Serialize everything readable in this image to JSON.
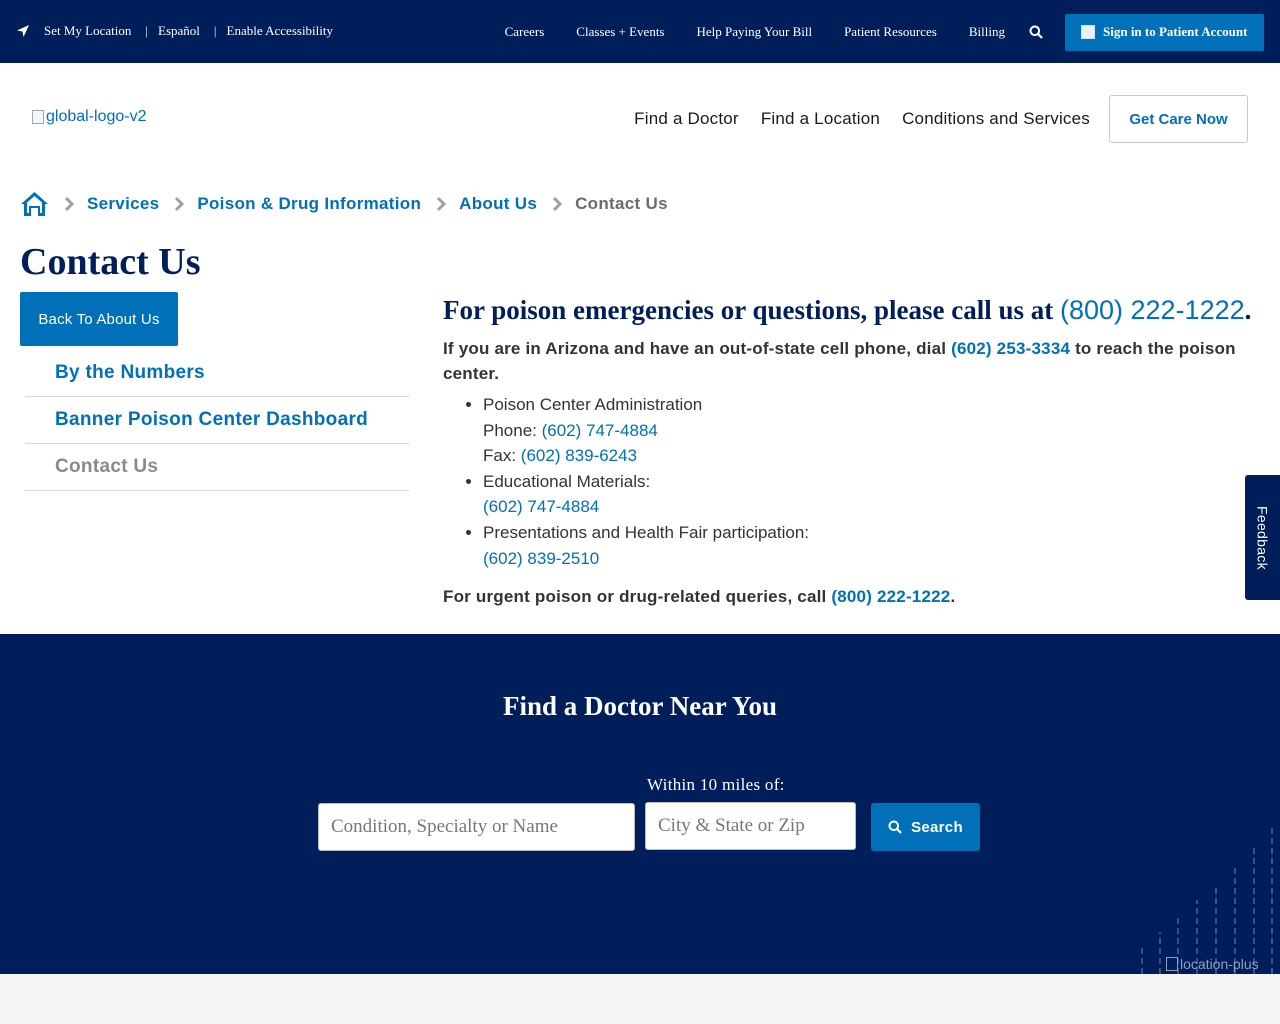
{
  "utility": {
    "set_location": "Set My Location",
    "espanol": "Español",
    "accessibility": "Enable Accessibility",
    "links": [
      "Careers",
      "Classes + Events",
      "Help Paying Your Bill",
      "Patient Resources",
      "Billing"
    ],
    "sign_in": "Sign in to Patient Account"
  },
  "header": {
    "logo_alt": "global-logo-v2",
    "nav": [
      "Find a Doctor",
      "Find a Location",
      "Conditions and Services"
    ],
    "get_care": "Get Care Now"
  },
  "breadcrumb": [
    "Services",
    "Poison & Drug Information",
    "About Us",
    "Contact Us"
  ],
  "page_title": "Contact Us",
  "sidebar": {
    "back": "Back To About Us",
    "items": [
      "By the Numbers",
      "Banner Poison Center Dashboard",
      "Contact Us"
    ]
  },
  "content": {
    "heading_text": "For poison emergencies or questions, please call us at ",
    "heading_phone": "(800) 222-1222",
    "heading_end": ".",
    "intro_pre": "If you are in Arizona and have an out-of-state cell phone, dial ",
    "intro_phone": "(602) 253-3334",
    "intro_post": " to reach the poison center.",
    "admin_label": "Poison Center Administration",
    "admin_phone_label": "Phone: ",
    "admin_phone": "(602) 747-4884",
    "admin_fax_label": "Fax: ",
    "admin_fax": "(602) 839-6243",
    "edu_label": "Educational Materials:",
    "edu_phone": "(602) 747-4884",
    "pres_label": "Presentations and Health Fair participation:",
    "pres_phone": "(602) 839-2510",
    "urgent_pre": "For urgent poison or drug-related queries, call ",
    "urgent_phone": "(800) 222-1222",
    "urgent_end": "."
  },
  "feedback": "Feedback",
  "find_doctor": {
    "title": "Find a Doctor Near You",
    "within": "Within 10 miles of:",
    "condition_placeholder": "Condition, Specialty or Name",
    "city_placeholder": "City & State or Zip",
    "search": "Search",
    "image_alt": "location-plus"
  },
  "colors": {
    "navy": "#001e5a",
    "link_blue": "#0070b8",
    "muted_gray": "#6b6b6b"
  }
}
